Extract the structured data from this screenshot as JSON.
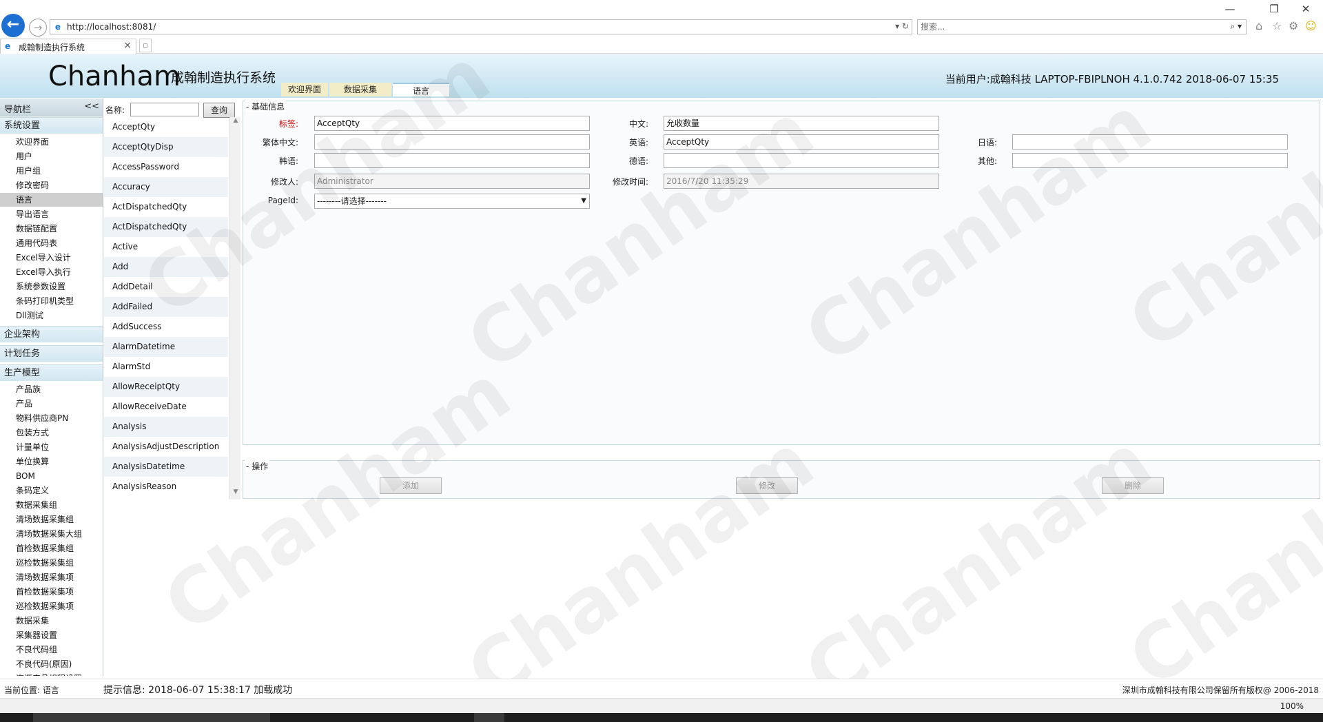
{
  "browser": {
    "url": "http://localhost:8081/",
    "search_placeholder": "搜索...",
    "tab_title": "成翰制造执行系统",
    "zoom": "100%"
  },
  "header": {
    "brand": "Chanham",
    "subtitle": "成翰制造执行系统",
    "tabs": [
      "欢迎界面",
      "数据采集",
      "语言"
    ],
    "user_info": "当前用户:成翰科技 LAPTOP-FBIPLNOH   4.1.0.742   2018-06-07 15:35"
  },
  "nav": {
    "title": "导航栏",
    "collapse": "<<",
    "groups": [
      {
        "label": "系统设置",
        "items": [
          "欢迎界面",
          "用户",
          "用户组",
          "修改密码",
          "语言",
          "导出语言",
          "数据链配置",
          "通用代码表",
          "Excel导入设计",
          "Excel导入执行",
          "系统参数设置",
          "条码打印机类型",
          "Dll测试"
        ]
      },
      {
        "label": "企业架构",
        "items": []
      },
      {
        "label": "计划任务",
        "items": []
      },
      {
        "label": "生产模型",
        "items": [
          "产品族",
          "产品",
          "物料供应商PN",
          "包装方式",
          "计量单位",
          "单位换算",
          "BOM",
          "条码定义",
          "数据采集组",
          "清场数据采集组",
          "清场数据采集大组",
          "首检数据采集组",
          "巡检数据采集组",
          "清场数据采集项",
          "首检数据采集项",
          "巡检数据采集项",
          "数据采集",
          "采集器设置",
          "不良代码组",
          "不良代码(原因)",
          "资源产品规程设置"
        ]
      }
    ],
    "active_item": "语言"
  },
  "list": {
    "name_label": "名称:",
    "name_value": "",
    "query_label": "查询",
    "rows": [
      "AcceptQty",
      "AcceptQtyDisp",
      "AccessPassword",
      "Accuracy",
      "ActDispatchedQty",
      "ActDispatchedQty",
      "Active",
      "Add",
      "AddDetail",
      "AddFailed",
      "AddSuccess",
      "AlarmDatetime",
      "AlarmStd",
      "AllowReceiptQty",
      "AllowReceiveDate",
      "Analysis",
      "AnalysisAdjustDescription",
      "AnalysisDatetime",
      "AnalysisReason"
    ]
  },
  "form": {
    "legend": "- 基础信息",
    "label_tag": "标签:",
    "value_tag": "AcceptQty",
    "label_cn": "中文:",
    "value_cn": "允收数量",
    "label_tw": "繁体中文:",
    "value_tw": "",
    "label_en": "英语:",
    "value_en": "AcceptQty",
    "label_jp": "日语:",
    "value_jp": "",
    "label_kr": "韩语:",
    "value_kr": "",
    "label_de": "德语:",
    "value_de": "",
    "label_other": "其他:",
    "value_other": "",
    "label_modifier": "修改人:",
    "value_modifier": "Administrator",
    "label_modtime": "修改时间:",
    "value_modtime": "2016/7/20 11:35:29",
    "label_pageid": "PageId:",
    "value_pageid": "--------请选择-------"
  },
  "ops": {
    "legend": "- 操作",
    "add": "添加",
    "edit": "修改",
    "delete": "删除"
  },
  "status": {
    "position": "当前位置:  语言",
    "message": "提示信息: 2018-06-07 15:38:17 加载成功",
    "copyright": "深圳市成翰科技有限公司保留所有版权@ 2006-2018"
  },
  "colors": {
    "header_gradient_top": "#e9f4fb",
    "header_gradient_bottom": "#bfe0ef",
    "required_label": "#d00000",
    "ie_blue": "#1d6fd1"
  }
}
